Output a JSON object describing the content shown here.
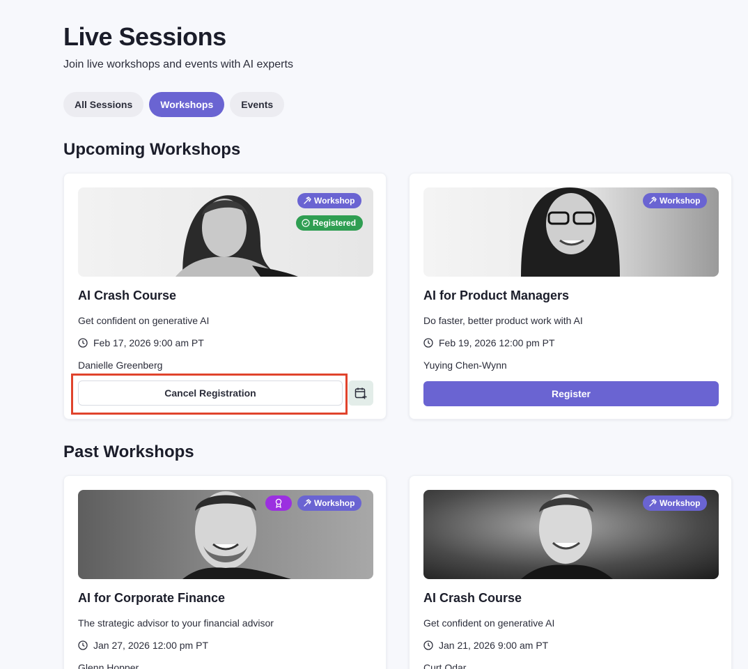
{
  "header": {
    "title": "Live Sessions",
    "subtitle": "Join live workshops and events with AI experts"
  },
  "tabs": [
    {
      "label": "All Sessions",
      "active": false
    },
    {
      "label": "Workshops",
      "active": true
    },
    {
      "label": "Events",
      "active": false
    }
  ],
  "upcoming": {
    "title": "Upcoming Workshops",
    "cards": [
      {
        "title": "AI Crash Course",
        "description": "Get confident on generative AI",
        "date": "Feb 17, 2026 9:00 am PT",
        "speaker": "Danielle Greenberg",
        "badge_type": "Workshop",
        "badge_status": "Registered",
        "action_label": "Cancel Registration"
      },
      {
        "title": "AI for Product Managers",
        "description": "Do faster, better product work with AI",
        "date": "Feb 19, 2026 12:00 pm PT",
        "speaker": "Yuying Chen-Wynn",
        "badge_type": "Workshop",
        "action_label": "Register"
      }
    ]
  },
  "past": {
    "title": "Past Workshops",
    "cards": [
      {
        "title": "AI for Corporate Finance",
        "description": "The strategic advisor to your financial advisor",
        "date": "Jan 27, 2026 12:00 pm PT",
        "speaker": "Glenn Hopper",
        "badge_type": "Workshop"
      },
      {
        "title": "AI Crash Course",
        "description": "Get confident on generative AI",
        "date": "Jan 21, 2026 9:00 am PT",
        "speaker": "Curt Odar",
        "badge_type": "Workshop"
      }
    ]
  },
  "colors": {
    "accent": "#6a64d2",
    "registered": "#2f9e52",
    "award": "#9b30e0",
    "highlight": "#e0432c"
  }
}
